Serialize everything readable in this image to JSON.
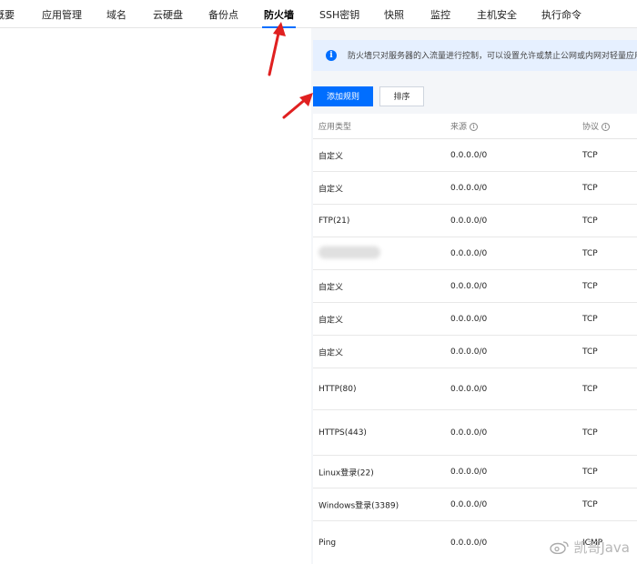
{
  "tabs": [
    {
      "label": "概要"
    },
    {
      "label": "应用管理"
    },
    {
      "label": "域名"
    },
    {
      "label": "云硬盘"
    },
    {
      "label": "备份点"
    },
    {
      "label": "防火墙"
    },
    {
      "label": "SSH密钥"
    },
    {
      "label": "快照"
    },
    {
      "label": "监控"
    },
    {
      "label": "主机安全"
    },
    {
      "label": "执行命令"
    }
  ],
  "active_tab": "防火墙",
  "notice": {
    "text": "防火墙只对服务器的入流量进行控制，可以设置允许或禁止公网或内网对轻量应用"
  },
  "toolbar": {
    "add_rule": "添加规则",
    "sort": "排序"
  },
  "table": {
    "headers": {
      "type": "应用类型",
      "source": "来源",
      "protocol": "协议"
    },
    "rows": [
      {
        "type": "自定义",
        "source": "0.0.0.0/0",
        "protocol": "TCP"
      },
      {
        "type": "自定义",
        "source": "0.0.0.0/0",
        "protocol": "TCP"
      },
      {
        "type": "FTP(21)",
        "source": "0.0.0.0/0",
        "protocol": "TCP"
      },
      {
        "type": "",
        "source": "0.0.0.0/0",
        "protocol": "TCP"
      },
      {
        "type": "自定义",
        "source": "0.0.0.0/0",
        "protocol": "TCP"
      },
      {
        "type": "自定义",
        "source": "0.0.0.0/0",
        "protocol": "TCP"
      },
      {
        "type": "自定义",
        "source": "0.0.0.0/0",
        "protocol": "TCP"
      },
      {
        "type": "HTTP(80)",
        "source": "0.0.0.0/0",
        "protocol": "TCP"
      },
      {
        "type": "HTTPS(443)",
        "source": "0.0.0.0/0",
        "protocol": "TCP"
      },
      {
        "type": "Linux登录(22)",
        "source": "0.0.0.0/0",
        "protocol": "TCP"
      },
      {
        "type": "Windows登录(3389)",
        "source": "0.0.0.0/0",
        "protocol": "TCP"
      },
      {
        "type": "Ping",
        "source": "0.0.0.0/0",
        "protocol": "ICMP"
      }
    ]
  },
  "watermark": {
    "text": "凯哥Java"
  },
  "colors": {
    "accent": "#006eff",
    "annotation_arrow": "#e02020",
    "notice_bg": "#e6f0ff"
  }
}
